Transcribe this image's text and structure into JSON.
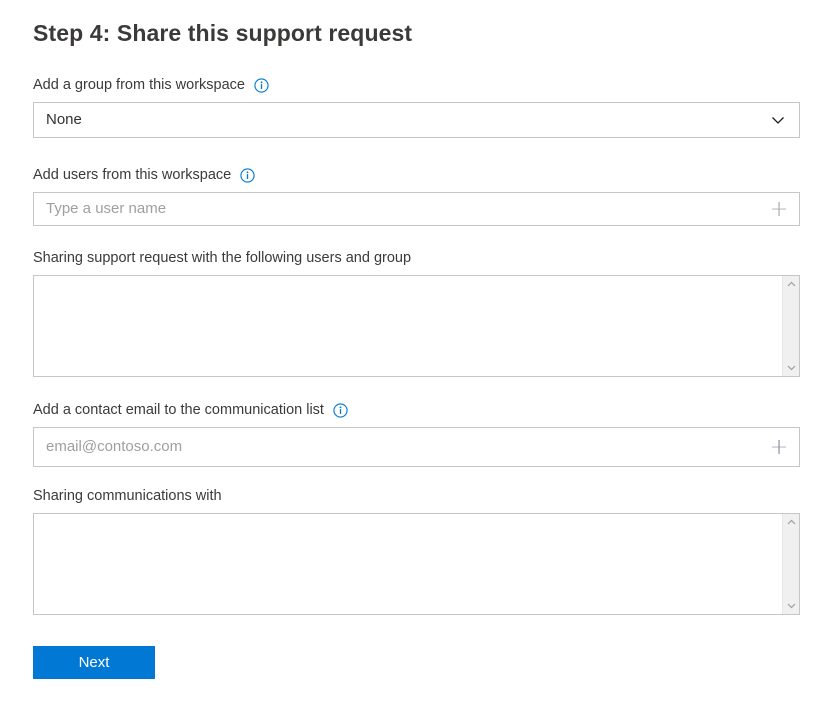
{
  "page": {
    "title": "Step 4: Share this support request"
  },
  "fields": {
    "group": {
      "label": "Add a group from this workspace",
      "info_icon": "info-circle-icon",
      "selected_value": "None",
      "chevron_icon": "chevron-down-icon"
    },
    "users": {
      "label": "Add users from this workspace",
      "info_icon": "info-circle-icon",
      "placeholder": "Type a user name",
      "value": "",
      "add_icon": "plus-icon"
    },
    "shared_with": {
      "label": "Sharing support request with the following users and group",
      "value": ""
    },
    "contact_email": {
      "label": "Add a contact email to the communication list",
      "info_icon": "info-circle-icon",
      "placeholder": "email@contoso.com",
      "value": "",
      "add_icon": "plus-icon"
    },
    "communications_with": {
      "label": "Sharing communications with",
      "value": ""
    }
  },
  "actions": {
    "next_label": "Next"
  },
  "colors": {
    "accent": "#0078d4",
    "info_icon": "#0078d4",
    "border": "#c8c6c4",
    "text": "#323130",
    "placeholder": "#a19f9d",
    "scrollbar_track": "#f0f0f0"
  }
}
